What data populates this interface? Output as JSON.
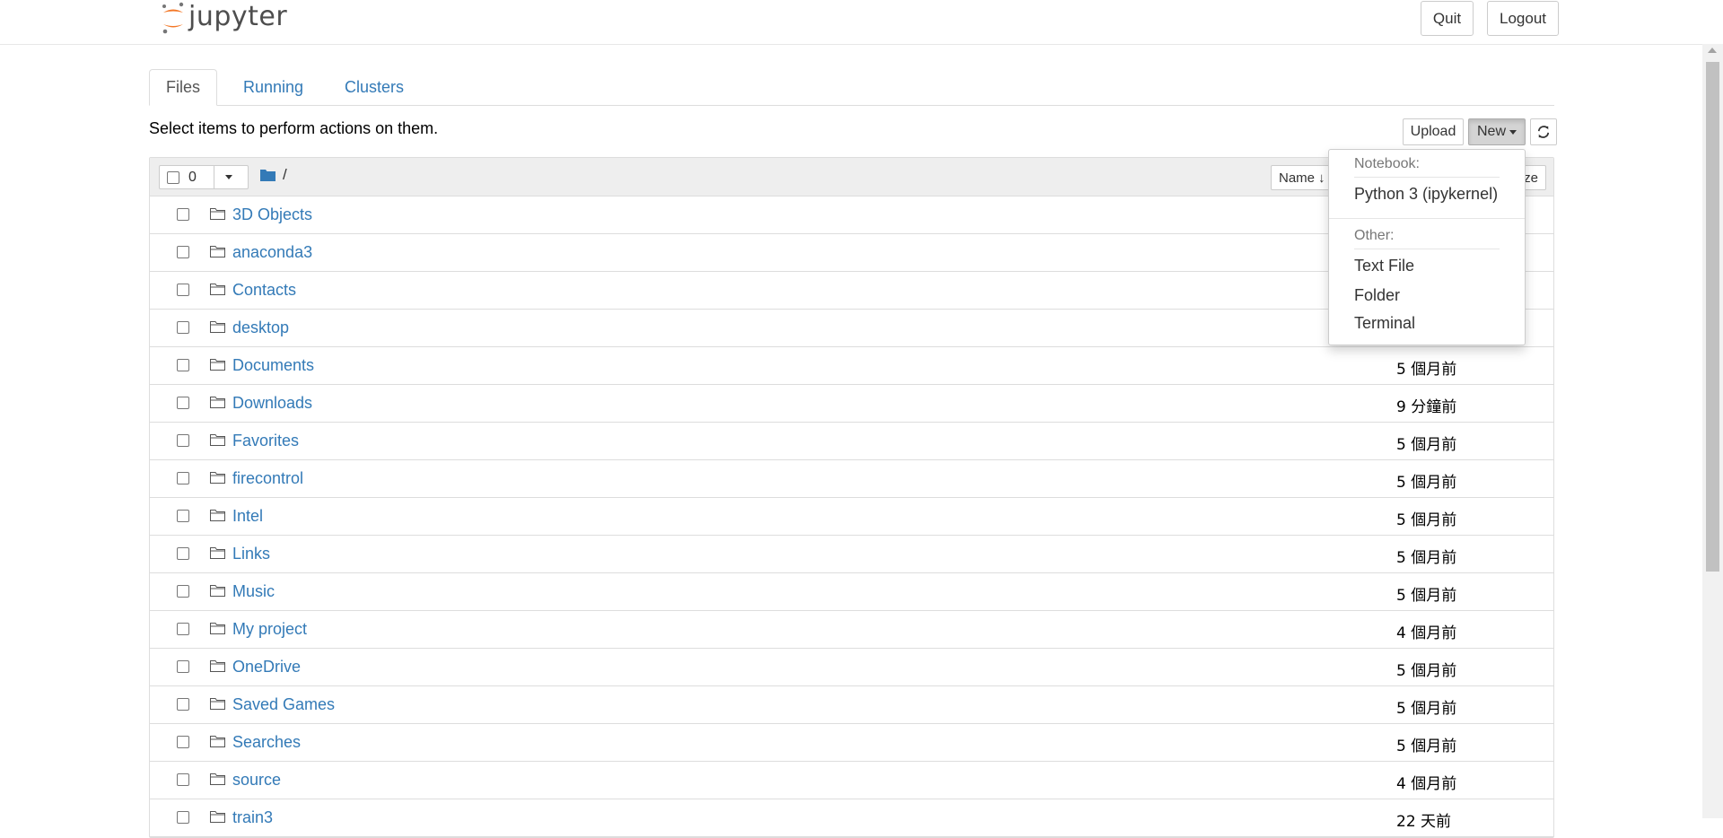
{
  "header": {
    "logo_text": "jupyter",
    "quit_label": "Quit",
    "logout_label": "Logout"
  },
  "tabs": [
    {
      "label": "Files",
      "active": true
    },
    {
      "label": "Running",
      "active": false
    },
    {
      "label": "Clusters",
      "active": false
    }
  ],
  "toolbar": {
    "instructions": "Select items to perform actions on them.",
    "upload_label": "Upload",
    "new_label": "New"
  },
  "list_header": {
    "selected_count": "0",
    "breadcrumb_root": "/",
    "sort_name_label": "Name",
    "sort_size_label": "ze"
  },
  "new_menu": {
    "notebook_header": "Notebook:",
    "python_kernel": "Python 3 (ipykernel)",
    "other_header": "Other:",
    "text_file": "Text File",
    "folder": "Folder",
    "terminal": "Terminal"
  },
  "files": [
    {
      "name": "3D Objects",
      "modified": ""
    },
    {
      "name": "anaconda3",
      "modified": ""
    },
    {
      "name": "Contacts",
      "modified": ""
    },
    {
      "name": "desktop",
      "modified": ""
    },
    {
      "name": "Documents",
      "modified": "5 個月前"
    },
    {
      "name": "Downloads",
      "modified": "9 分鐘前"
    },
    {
      "name": "Favorites",
      "modified": "5 個月前"
    },
    {
      "name": "firecontrol",
      "modified": "5 個月前"
    },
    {
      "name": "Intel",
      "modified": "5 個月前"
    },
    {
      "name": "Links",
      "modified": "5 個月前"
    },
    {
      "name": "Music",
      "modified": "5 個月前"
    },
    {
      "name": "My project",
      "modified": "4 個月前"
    },
    {
      "name": "OneDrive",
      "modified": "5 個月前"
    },
    {
      "name": "Saved Games",
      "modified": "5 個月前"
    },
    {
      "name": "Searches",
      "modified": "5 個月前"
    },
    {
      "name": "source",
      "modified": "4 個月前"
    },
    {
      "name": "train3",
      "modified": "22 天前"
    }
  ],
  "colors": {
    "link": "#337ab7",
    "jupyter_orange": "#f37726"
  }
}
